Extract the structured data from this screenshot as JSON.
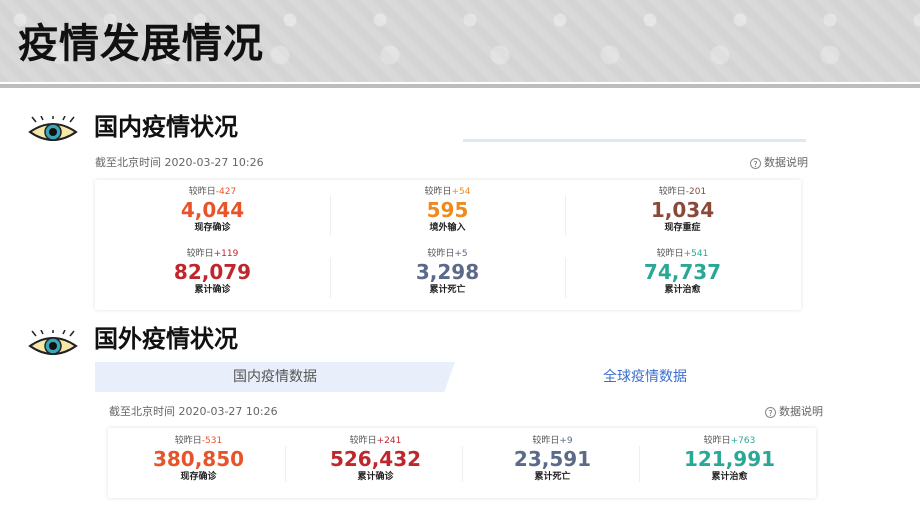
{
  "header": {
    "title": "疫情发展情况"
  },
  "domestic": {
    "section_title": "国内疫情状况",
    "time": "截至北京时间 2020-03-27 10:26",
    "help": "数据说明",
    "stats": [
      {
        "cmp_prefix": "较昨日",
        "delta": "-427",
        "value": "4,044",
        "label": "现存确诊",
        "color": "#e8542a",
        "delta_color": "#e8542a"
      },
      {
        "cmp_prefix": "较昨日",
        "delta": "+54",
        "value": "595",
        "label": "境外输入",
        "color": "#f08a1c",
        "delta_color": "#f08a1c"
      },
      {
        "cmp_prefix": "较昨日",
        "delta": "-201",
        "value": "1,034",
        "label": "现存重症",
        "color": "#8a4a3a",
        "delta_color": "#8a4a3a"
      },
      {
        "cmp_prefix": "较昨日",
        "delta": "+119",
        "value": "82,079",
        "label": "累计确诊",
        "color": "#c0262d",
        "delta_color": "#c0262d"
      },
      {
        "cmp_prefix": "较昨日",
        "delta": "+5",
        "value": "3,298",
        "label": "累计死亡",
        "color": "#5a6a88",
        "delta_color": "#5a6a88"
      },
      {
        "cmp_prefix": "较昨日",
        "delta": "+541",
        "value": "74,737",
        "label": "累计治愈",
        "color": "#29a896",
        "delta_color": "#29a896"
      }
    ]
  },
  "foreign": {
    "section_title": "国外疫情状况",
    "tabs": [
      "国内疫情数据",
      "全球疫情数据"
    ],
    "time": "截至北京时间 2020-03-27 10:26",
    "help": "数据说明",
    "stats": [
      {
        "cmp_prefix": "较昨日",
        "delta": "-531",
        "value": "380,850",
        "label": "现存确诊",
        "color": "#e8542a",
        "delta_color": "#e8542a"
      },
      {
        "cmp_prefix": "较昨日",
        "delta": "+241",
        "value": "526,432",
        "label": "累计确诊",
        "color": "#c0262d",
        "delta_color": "#c0262d"
      },
      {
        "cmp_prefix": "较昨日",
        "delta": "+9",
        "value": "23,591",
        "label": "累计死亡",
        "color": "#5a6a88",
        "delta_color": "#5a6a88"
      },
      {
        "cmp_prefix": "较昨日",
        "delta": "+763",
        "value": "121,991",
        "label": "累计治愈",
        "color": "#29a896",
        "delta_color": "#29a896"
      }
    ]
  },
  "icons": {
    "section_icon": "eye-icon",
    "help_icon": "question-circle-icon"
  }
}
